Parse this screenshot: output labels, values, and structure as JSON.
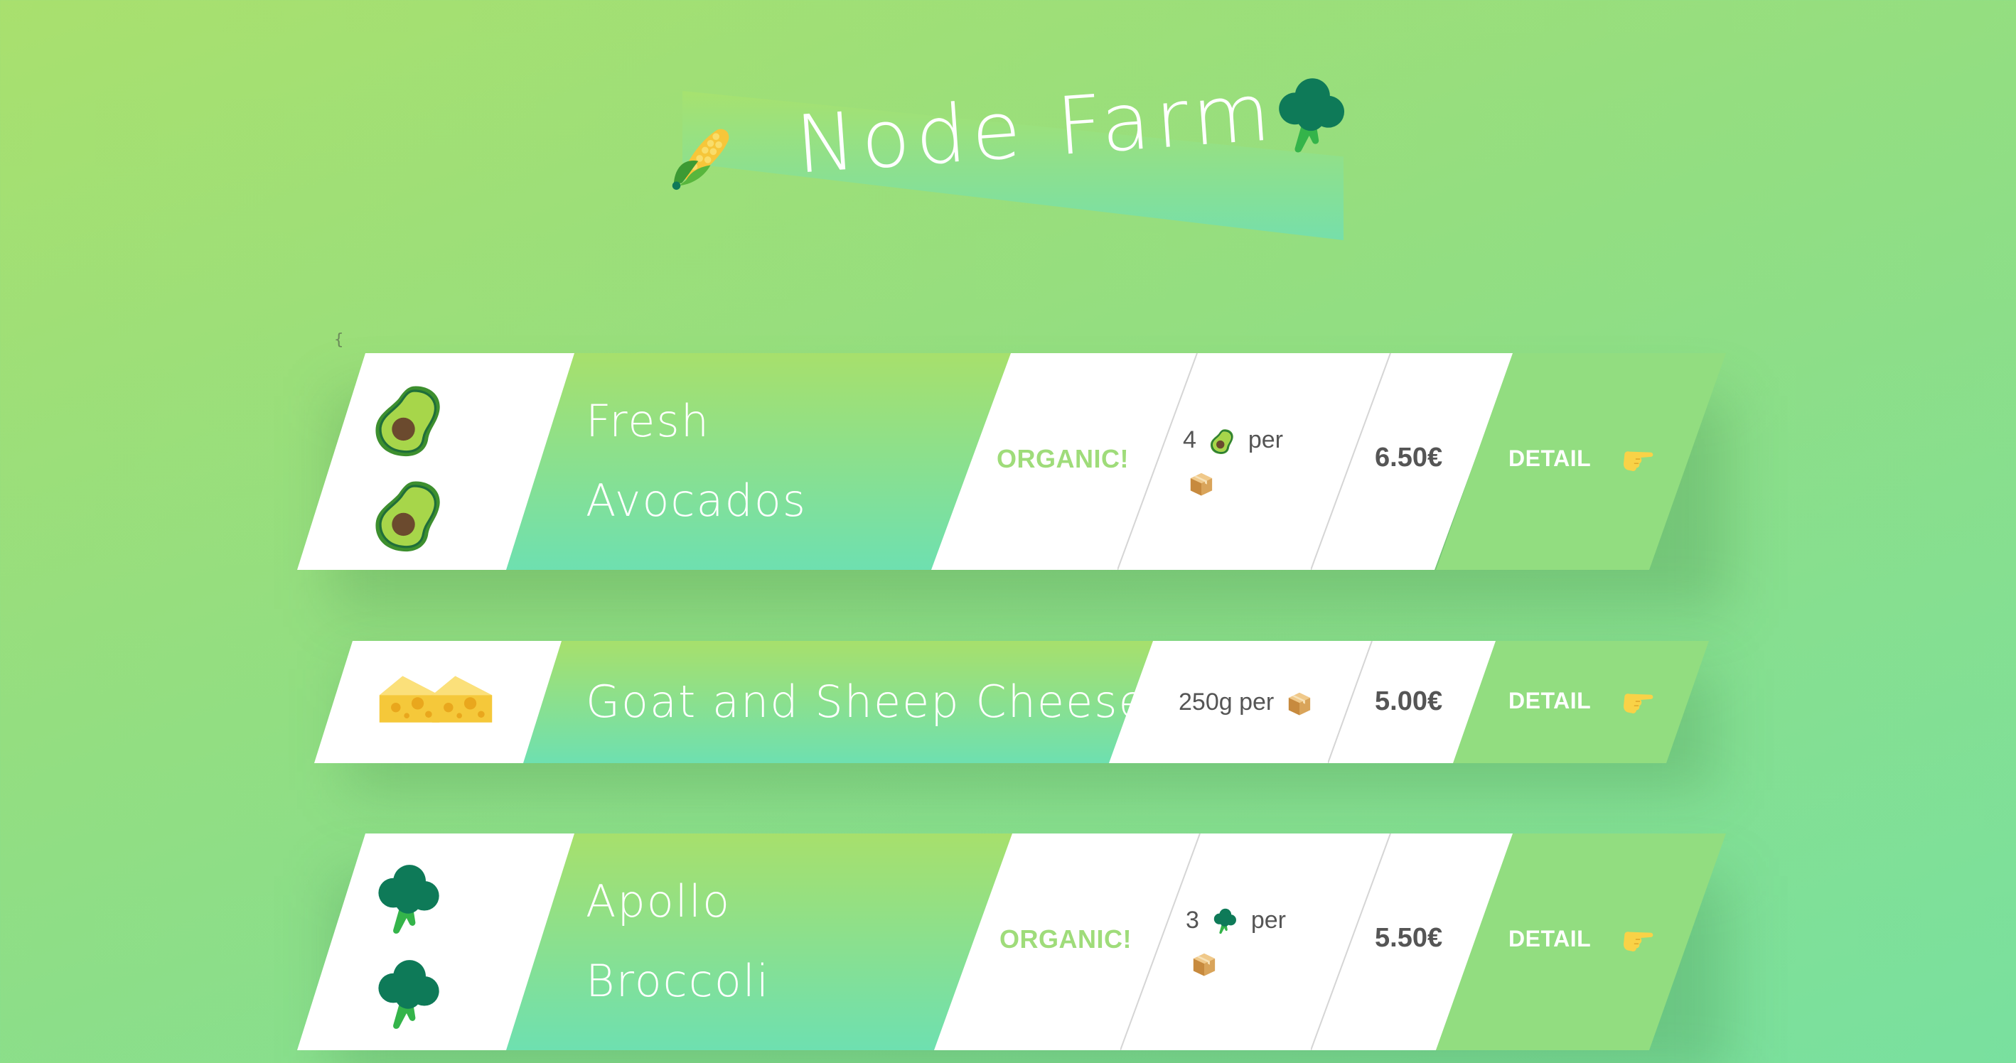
{
  "header": {
    "title": "Node Farm",
    "left_icon": "corn-icon",
    "right_icon": "broccoli-icon"
  },
  "stray_text": "{",
  "products": [
    {
      "name_line1": "Fresh",
      "name_line2": "Avocados",
      "icon": "avocado-icon",
      "organic": "ORGANIC!",
      "quantity_prefix": "4",
      "quantity_suffix": "per",
      "price": "6.50€",
      "detail_label": "DETAIL"
    },
    {
      "name_line1": "Goat and Sheep Cheese",
      "name_line2": "",
      "icon": "cheese-icon",
      "organic": "",
      "quantity_prefix": "250g per",
      "quantity_suffix": "",
      "price": "5.00€",
      "detail_label": "DETAIL"
    },
    {
      "name_line1": "Apollo",
      "name_line2": "Broccoli",
      "icon": "broccoli-icon",
      "organic": "ORGANIC!",
      "quantity_prefix": "3",
      "quantity_suffix": "per",
      "price": "5.50€",
      "detail_label": "DETAIL"
    }
  ],
  "colors": {
    "background_start": "#a9e06e",
    "background_end": "#79e09f",
    "organic_text": "#9fdc7a",
    "detail_panel": "#92dd80",
    "name_gradient_top": "#a7e06c",
    "name_gradient_bottom": "#6ee0b0"
  }
}
